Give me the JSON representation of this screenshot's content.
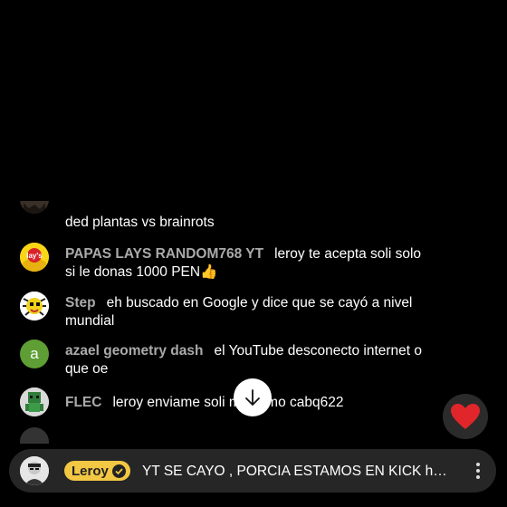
{
  "chat": {
    "messages": [
      {
        "author": "",
        "text": "ded plantas vs brainrots",
        "avatar_icon": "partial-avatar"
      },
      {
        "author": "PAPAS LAYS RANDOM768 YT",
        "text": "leroy te acepta soli solo si le donas 1000 PEN👍",
        "avatar_icon": "lays-logo-icon"
      },
      {
        "author": "Step",
        "text": "eh buscado en Google y dice que se cayó a nivel mundial",
        "avatar_icon": "yellow-creature-icon"
      },
      {
        "author": "azael geometry dash",
        "text": "el YouTube desconecto internet o que oe",
        "avatar_icon": "letter-avatar",
        "avatar_letter": "a",
        "avatar_color": "#5e9e34"
      },
      {
        "author": "FLEC",
        "text": "leroy enviame soli      me llamo cabq622",
        "avatar_icon": "pixel-character-icon"
      }
    ]
  },
  "controls": {
    "scroll_icon": "arrow-down-icon",
    "heart_icon": "heart-icon",
    "heart_color": "#e0262b"
  },
  "pinned": {
    "badge_label": "Leroy",
    "badge_color": "#f2c744",
    "text": "YT SE CAYO , PORCIA ESTAMOS EN KICK htt...",
    "more_icon": "more-vertical-icon"
  }
}
